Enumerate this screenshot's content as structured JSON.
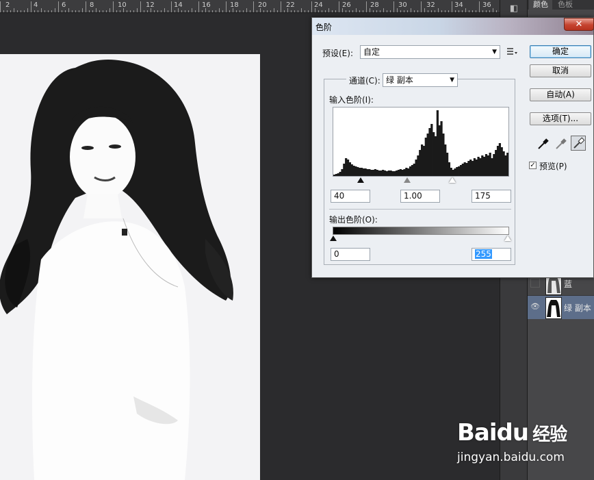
{
  "ruler": {
    "numbers": [
      "2",
      "4",
      "6",
      "8",
      "10",
      "12",
      "14",
      "16",
      "18",
      "20",
      "22",
      "24",
      "26",
      "28",
      "30",
      "32",
      "34",
      "36"
    ]
  },
  "panel": {
    "tabs": [
      "颜色",
      "色板"
    ],
    "layers": [
      {
        "name": "蓝",
        "visible": false
      },
      {
        "name": "绿 副本",
        "visible": true,
        "selected": true
      }
    ]
  },
  "dialog": {
    "title": "色阶",
    "close_label": "✕",
    "preset_label": "预设(E):",
    "preset_value": "自定",
    "channel_label": "通道(C):",
    "channel_value": "绿 副本",
    "input_levels_label": "输入色阶(I):",
    "input_black": "40",
    "input_gamma": "1.00",
    "input_white": "175",
    "output_levels_label": "输出色阶(O):",
    "output_black": "0",
    "output_white": "255",
    "buttons": {
      "ok": "确定",
      "cancel": "取消",
      "auto": "自动(A)",
      "options": "选项(T)..."
    },
    "preview_label": "预览(P)",
    "preview_checked": true,
    "histogram_sample": [
      2,
      3,
      4,
      6,
      10,
      18,
      26,
      24,
      20,
      17,
      15,
      14,
      13,
      12,
      12,
      11,
      11,
      10,
      10,
      9,
      9,
      10,
      9,
      8,
      8,
      9,
      8,
      7,
      8,
      8,
      7,
      7,
      8,
      9,
      10,
      9,
      10,
      12,
      11,
      14,
      16,
      18,
      24,
      30,
      38,
      46,
      44,
      56,
      62,
      70,
      76,
      64,
      58,
      96,
      74,
      80,
      62,
      46,
      34,
      20,
      12,
      9,
      11,
      13,
      14,
      16,
      18,
      20,
      19,
      22,
      24,
      22,
      26,
      24,
      28,
      26,
      30,
      28,
      32,
      30,
      34,
      26,
      32,
      38,
      44,
      48,
      42,
      36,
      30,
      34
    ]
  },
  "watermark": {
    "brand": "Baidu",
    "suffix": "经验",
    "url": "jingyan.baidu.com"
  }
}
